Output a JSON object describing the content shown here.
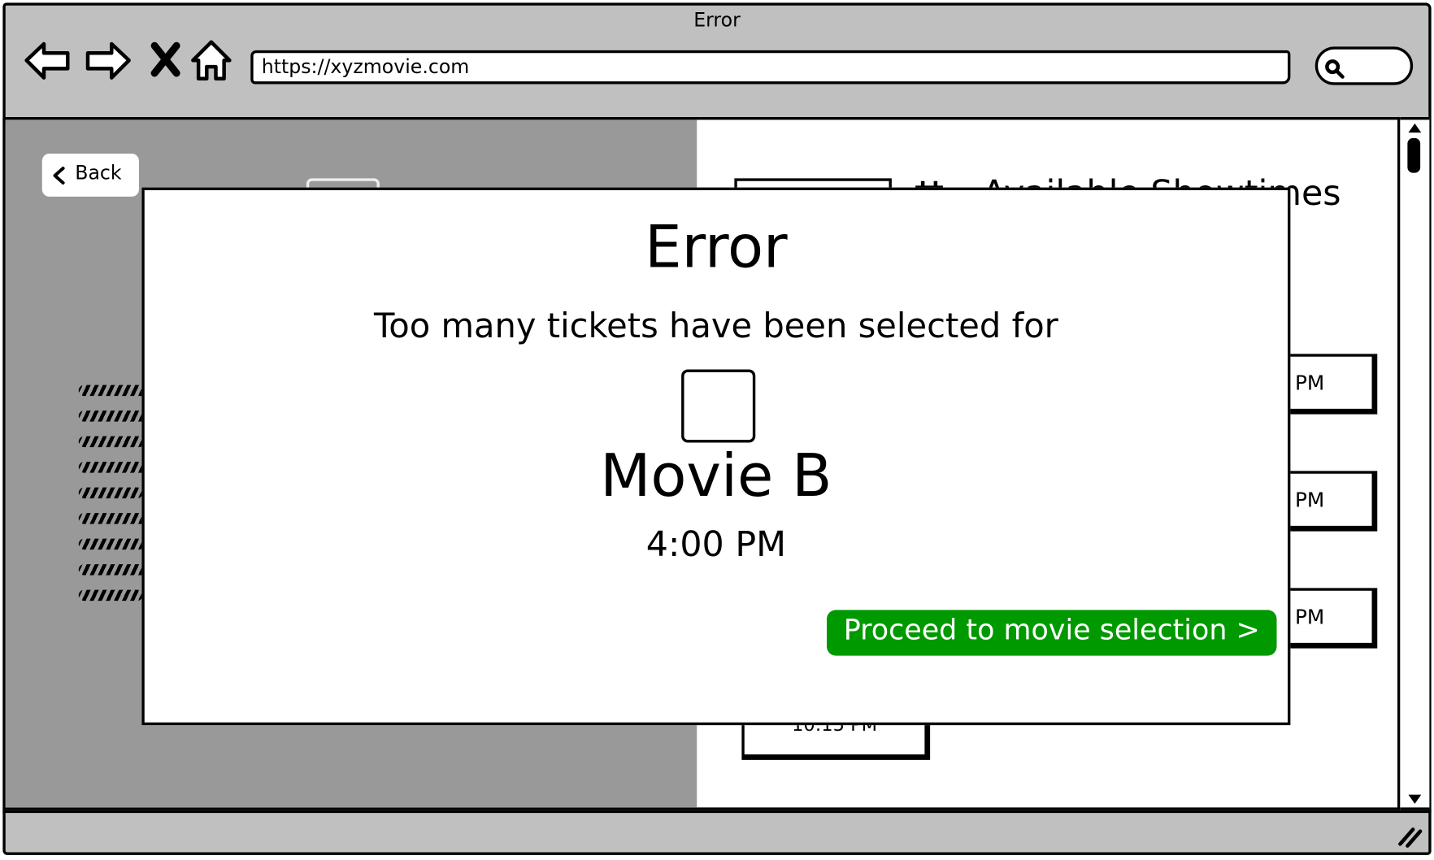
{
  "browser": {
    "title": "Error",
    "url": "https://xyzmovie.com",
    "nav_icons": [
      "back-arrow-icon",
      "forward-arrow-icon",
      "stop-icon",
      "home-icon"
    ]
  },
  "page": {
    "back_label": "Back",
    "showtimes_heading": "Available Showtimes",
    "time_buttons": [
      "PM",
      "PM",
      "PM",
      "10:15 PM"
    ]
  },
  "modal": {
    "title": "Error",
    "message": "Too many tickets have been selected for",
    "movie": "Movie B",
    "time": "4:00 PM",
    "proceed_label": "Proceed to movie selection >"
  },
  "colors": {
    "chrome": "#c0c0c0",
    "dim_panel": "#999999",
    "accent_green": "#009900"
  }
}
